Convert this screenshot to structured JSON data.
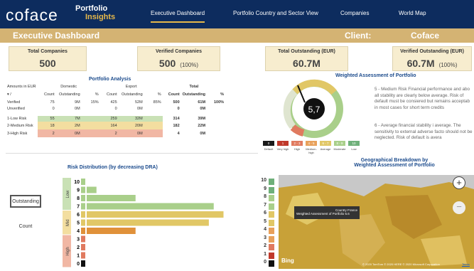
{
  "header": {
    "logo": "coface",
    "brand_title": "Portfolio",
    "brand_sub": "Insights",
    "nav": [
      "Executive Dashboard",
      "Portfolio Country and Sector View",
      "Companies",
      "World Map"
    ]
  },
  "band": {
    "title": "Executive Dashboard",
    "client_label": "Client:",
    "client_value": "Coface"
  },
  "kpis": [
    {
      "title": "Total Companies",
      "value": "500",
      "pct": ""
    },
    {
      "title": "Verified Companies",
      "value": "500",
      "pct": "(100%)"
    },
    {
      "title": "Total Outstanding (EUR)",
      "value": "60.7M",
      "pct": ""
    },
    {
      "title": "Verified Outstanding (EUR)",
      "value": "60.7M",
      "pct": "(100%)"
    }
  ],
  "portfolio_analysis": {
    "title": "Portfolio Analysis",
    "header1": [
      "Amounts in EUR",
      "Domestic",
      "Export",
      "Total"
    ],
    "header2": [
      "▾ /",
      "Count",
      "Outstanding",
      "%",
      "Count",
      "Outstanding",
      "%",
      "Count",
      "Outstanding",
      "%"
    ],
    "rows": [
      [
        "Verified",
        "75",
        "9M",
        "15%",
        "425",
        "52M",
        "85%",
        "500",
        "61M",
        "100%"
      ],
      [
        "Unverified",
        "0",
        "0M",
        "",
        "0",
        "0M",
        "",
        "0",
        "0M",
        ""
      ],
      [
        "1-Low Risk",
        "55",
        "7M",
        "",
        "259",
        "32M",
        "",
        "314",
        "39M",
        ""
      ],
      [
        "2-Medium Risk",
        "18",
        "2M",
        "",
        "164",
        "20M",
        "",
        "182",
        "22M",
        ""
      ],
      [
        "3-High Risk",
        "2",
        "0M",
        "",
        "2",
        "0M",
        "",
        "4",
        "0M",
        ""
      ]
    ]
  },
  "gauge": {
    "title": "Weighted Assessment of Portfolio",
    "value": "5,7",
    "segments": [
      {
        "label": "0",
        "caption": "Default",
        "color": "#1a1a1a"
      },
      {
        "label": "1",
        "caption": "Very high",
        "color": "#c0392b"
      },
      {
        "label": "2 - 3",
        "caption": "High",
        "color": "#e07a5f"
      },
      {
        "label": "4 - 5",
        "caption": "Medium-high",
        "color": "#e8a15b"
      },
      {
        "label": "6 - 7",
        "caption": "Average",
        "color": "#e1c766"
      },
      {
        "label": "8 - 9",
        "caption": "Moderate",
        "color": "#a9cf8a"
      },
      {
        "label": "10",
        "caption": "Low",
        "color": "#6fb07a"
      }
    ],
    "text1": "5 - Medium Risk Financial performance and abo all stability are clearly below average. Risk of default must be consiered but remains acceptab in most cases for short term credits",
    "text2": "6 - Average financial stability i average. The sensitivity to external adverse facto should not be neglected. Risk of default is avera"
  },
  "side_buttons": {
    "outstanding": "Outstanding",
    "count": "Count"
  },
  "chart_data": {
    "type": "bar",
    "title": "Risk Distribution (by decreasing DRA)",
    "categories": [
      "10",
      "9",
      "8",
      "7",
      "6",
      "5",
      "4",
      "3",
      "2",
      "1",
      "0"
    ],
    "values": [
      0,
      2,
      10,
      26,
      28,
      25,
      10,
      0,
      0,
      0,
      0
    ],
    "xlabel": "",
    "ylabel": "",
    "xlim": [
      0,
      32
    ],
    "xticks": [
      "0%",
      "10%",
      "20%",
      "30%"
    ],
    "groups": [
      {
        "name": "Low",
        "from": 0,
        "to": 3
      },
      {
        "name": "Mid",
        "from": 4,
        "to": 6
      },
      {
        "name": "High",
        "from": 7,
        "to": 10
      }
    ],
    "colors": {
      "low": "#a9cf8a",
      "mid": "#e1c766",
      "orange": "#e0913a"
    }
  },
  "map": {
    "title_line1": "Geographical Breakdown by",
    "title_line2": "Weighted Assessment of Portfolio",
    "tooltip_country_label": "Country",
    "tooltip_country": "France",
    "tooltip_metric_label": "Weighted Assessment of Portfolio",
    "tooltip_metric": "5.6",
    "bing": "Bing",
    "copyright": "© 2020 TomTom © 2020 HERE © 2020 Microsoft Corporation",
    "terms": "Terms",
    "numbers": [
      "10",
      "9",
      "8",
      "7",
      "6",
      "5",
      "4",
      "3",
      "2",
      "1",
      "0"
    ]
  }
}
